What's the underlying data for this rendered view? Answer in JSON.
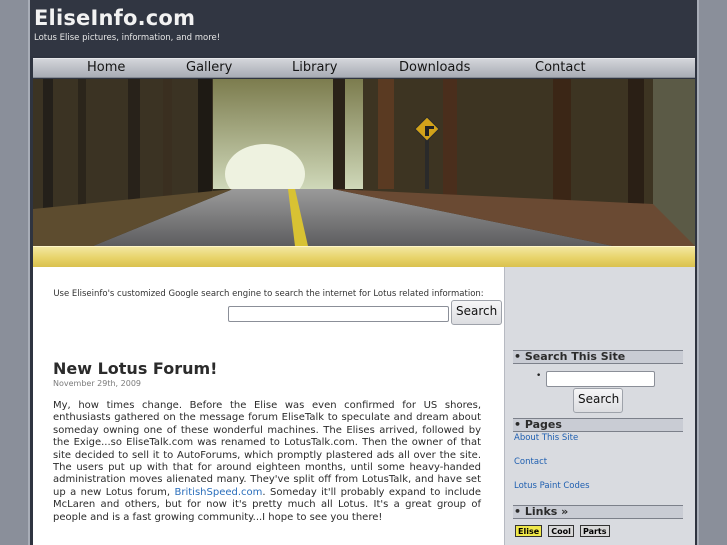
{
  "header": {
    "title": "EliseInfo.com",
    "tagline": "Lotus Elise pictures, information, and more!"
  },
  "nav": {
    "items": [
      "Home",
      "Gallery",
      "Library",
      "Downloads",
      "Contact"
    ]
  },
  "search_google": {
    "note": "Use Eliseinfo's customized Google search engine to search the internet for Lotus related information:",
    "button": "Search",
    "value": ""
  },
  "post": {
    "title": "New Lotus Forum!",
    "date": "November 29th, 2009",
    "body_before_link": "My, how times change. Before the Elise was even confirmed for US shores, enthusiasts gathered on the message forum EliseTalk to speculate and dream about someday owning one of these wonderful machines. The Elises arrived, followed by the Exige...so EliseTalk.com was renamed to LotusTalk.com. Then the owner of that site decided to sell it to AutoForums, which promptly plastered ads all over the site. The users put up with that for around eighteen months, until some heavy-handed administration moves alienated many. They've split off from LotusTalk, and have set up a new Lotus forum, ",
    "link_text": "BritishSpeed.com",
    "body_after_link": ". Someday it'll probably expand to include McLaren and others, but for now it's pretty much all Lotus. It's a great group of people and is a fast growing community...I hope to see you there!"
  },
  "sidebar": {
    "search_heading": "• Search This Site",
    "search_button": "Search",
    "bullet": "•",
    "pages_heading": "• Pages",
    "pages": [
      "About This Site",
      "Contact",
      "Lotus Paint Codes"
    ],
    "links_heading": "• Links »",
    "badges": [
      "Elise",
      "Cool",
      "Parts"
    ]
  },
  "colors": {
    "header_bg": "#313642",
    "gold_bar": "#e8d36a",
    "link": "#2a6ebb"
  }
}
